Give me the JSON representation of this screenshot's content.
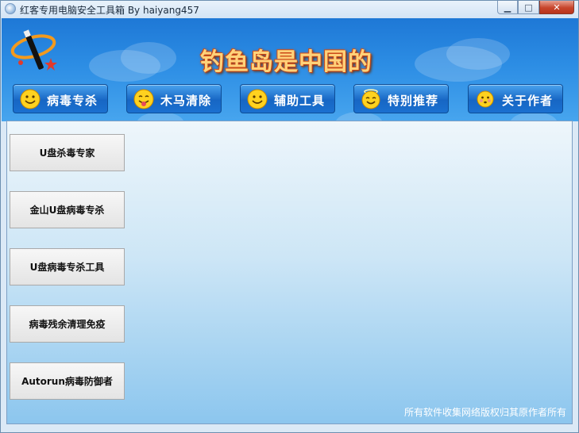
{
  "window": {
    "title": "红客专用电脑安全工具箱  By haiyang457",
    "controls": {
      "minimize": "▁",
      "maximize": "□",
      "close": "✕"
    }
  },
  "banner": {
    "slogan": "钓鱼岛是中国的",
    "logo_icon": "magic-wand-icon"
  },
  "nav": [
    {
      "label": "病毒专杀",
      "icon": "smiley-icon"
    },
    {
      "label": "木马清除",
      "icon": "tongue-out-smiley-icon"
    },
    {
      "label": "辅助工具",
      "icon": "smiley-icon"
    },
    {
      "label": "特别推荐",
      "icon": "angel-smiley-icon"
    },
    {
      "label": "关于作者",
      "icon": "blush-smiley-icon"
    }
  ],
  "sidebar": [
    {
      "label": "U盘杀毒专家"
    },
    {
      "label": "金山U盘病毒专杀"
    },
    {
      "label": "U盘病毒专杀工具"
    },
    {
      "label": "病毒残余清理免疫"
    },
    {
      "label": "Autorun病毒防御者"
    }
  ],
  "footer": {
    "text": "所有软件收集网络版权归其原作者所有"
  },
  "colors": {
    "banner": "#1e78d6",
    "slogan": "#ffd27a",
    "nav_button": "#1766c4",
    "content_bg": "#cde6f6"
  }
}
